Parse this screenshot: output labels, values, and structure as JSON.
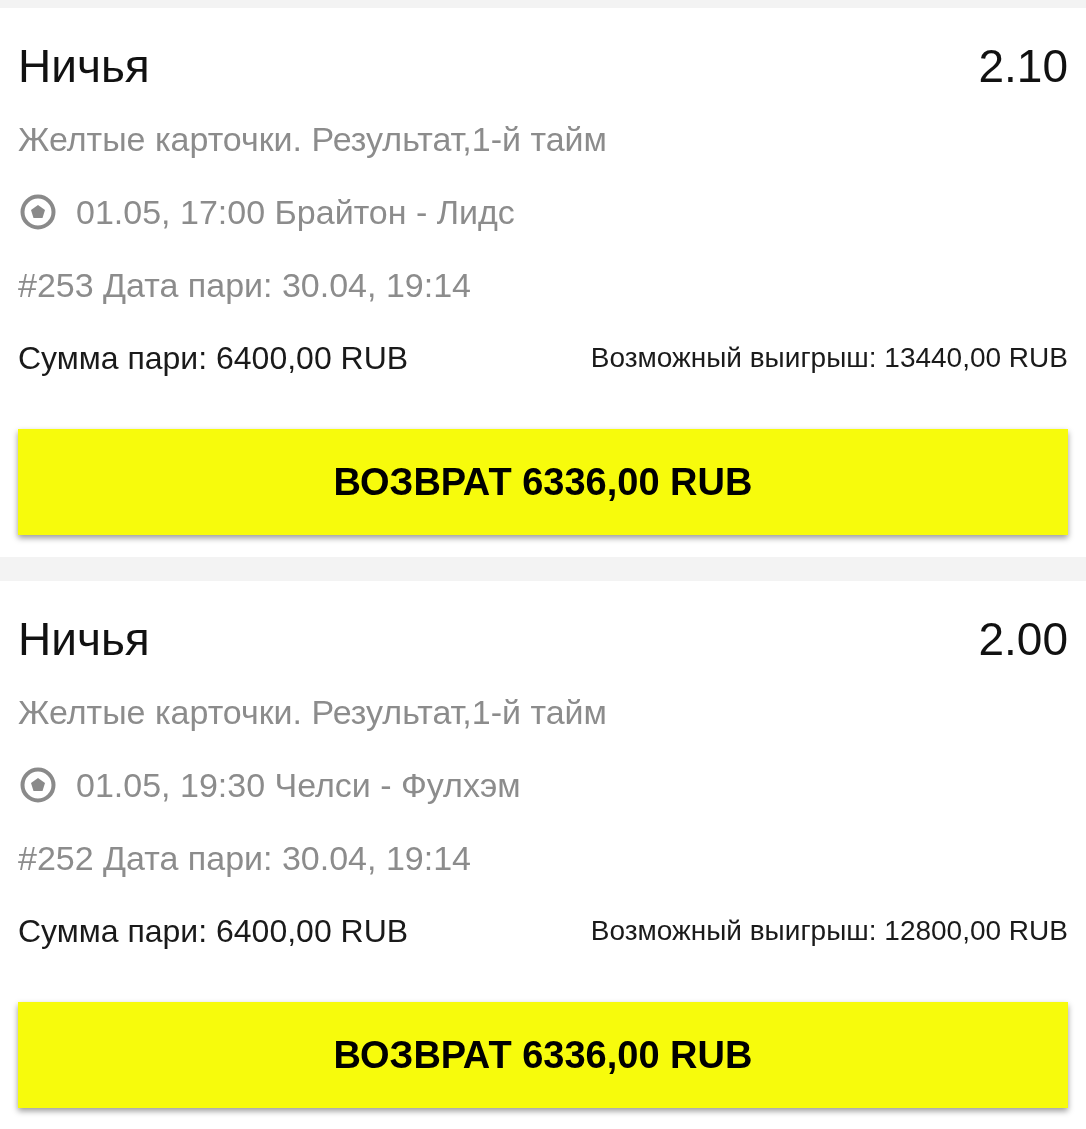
{
  "bets": [
    {
      "outcome": "Ничья",
      "odds": "2.10",
      "market": "Желтые карточки. Результат,1-й тайм",
      "event": "01.05, 17:00 Брайтон - Лидс",
      "bet_info": "#253 Дата пари: 30.04, 19:14",
      "stake": "Сумма пари: 6400,00 RUB",
      "potential_win": "Возможный выигрыш: 13440,00 RUB",
      "cashout_button": "ВОЗВРАТ 6336,00 RUB"
    },
    {
      "outcome": "Ничья",
      "odds": "2.00",
      "market": "Желтые карточки. Результат,1-й тайм",
      "event": "01.05, 19:30 Челси - Фулхэм",
      "bet_info": "#252 Дата пари: 30.04, 19:14",
      "stake": "Сумма пари: 6400,00 RUB",
      "potential_win": "Возможный выигрыш: 12800,00 RUB",
      "cashout_button": "ВОЗВРАТ 6336,00 RUB"
    }
  ]
}
